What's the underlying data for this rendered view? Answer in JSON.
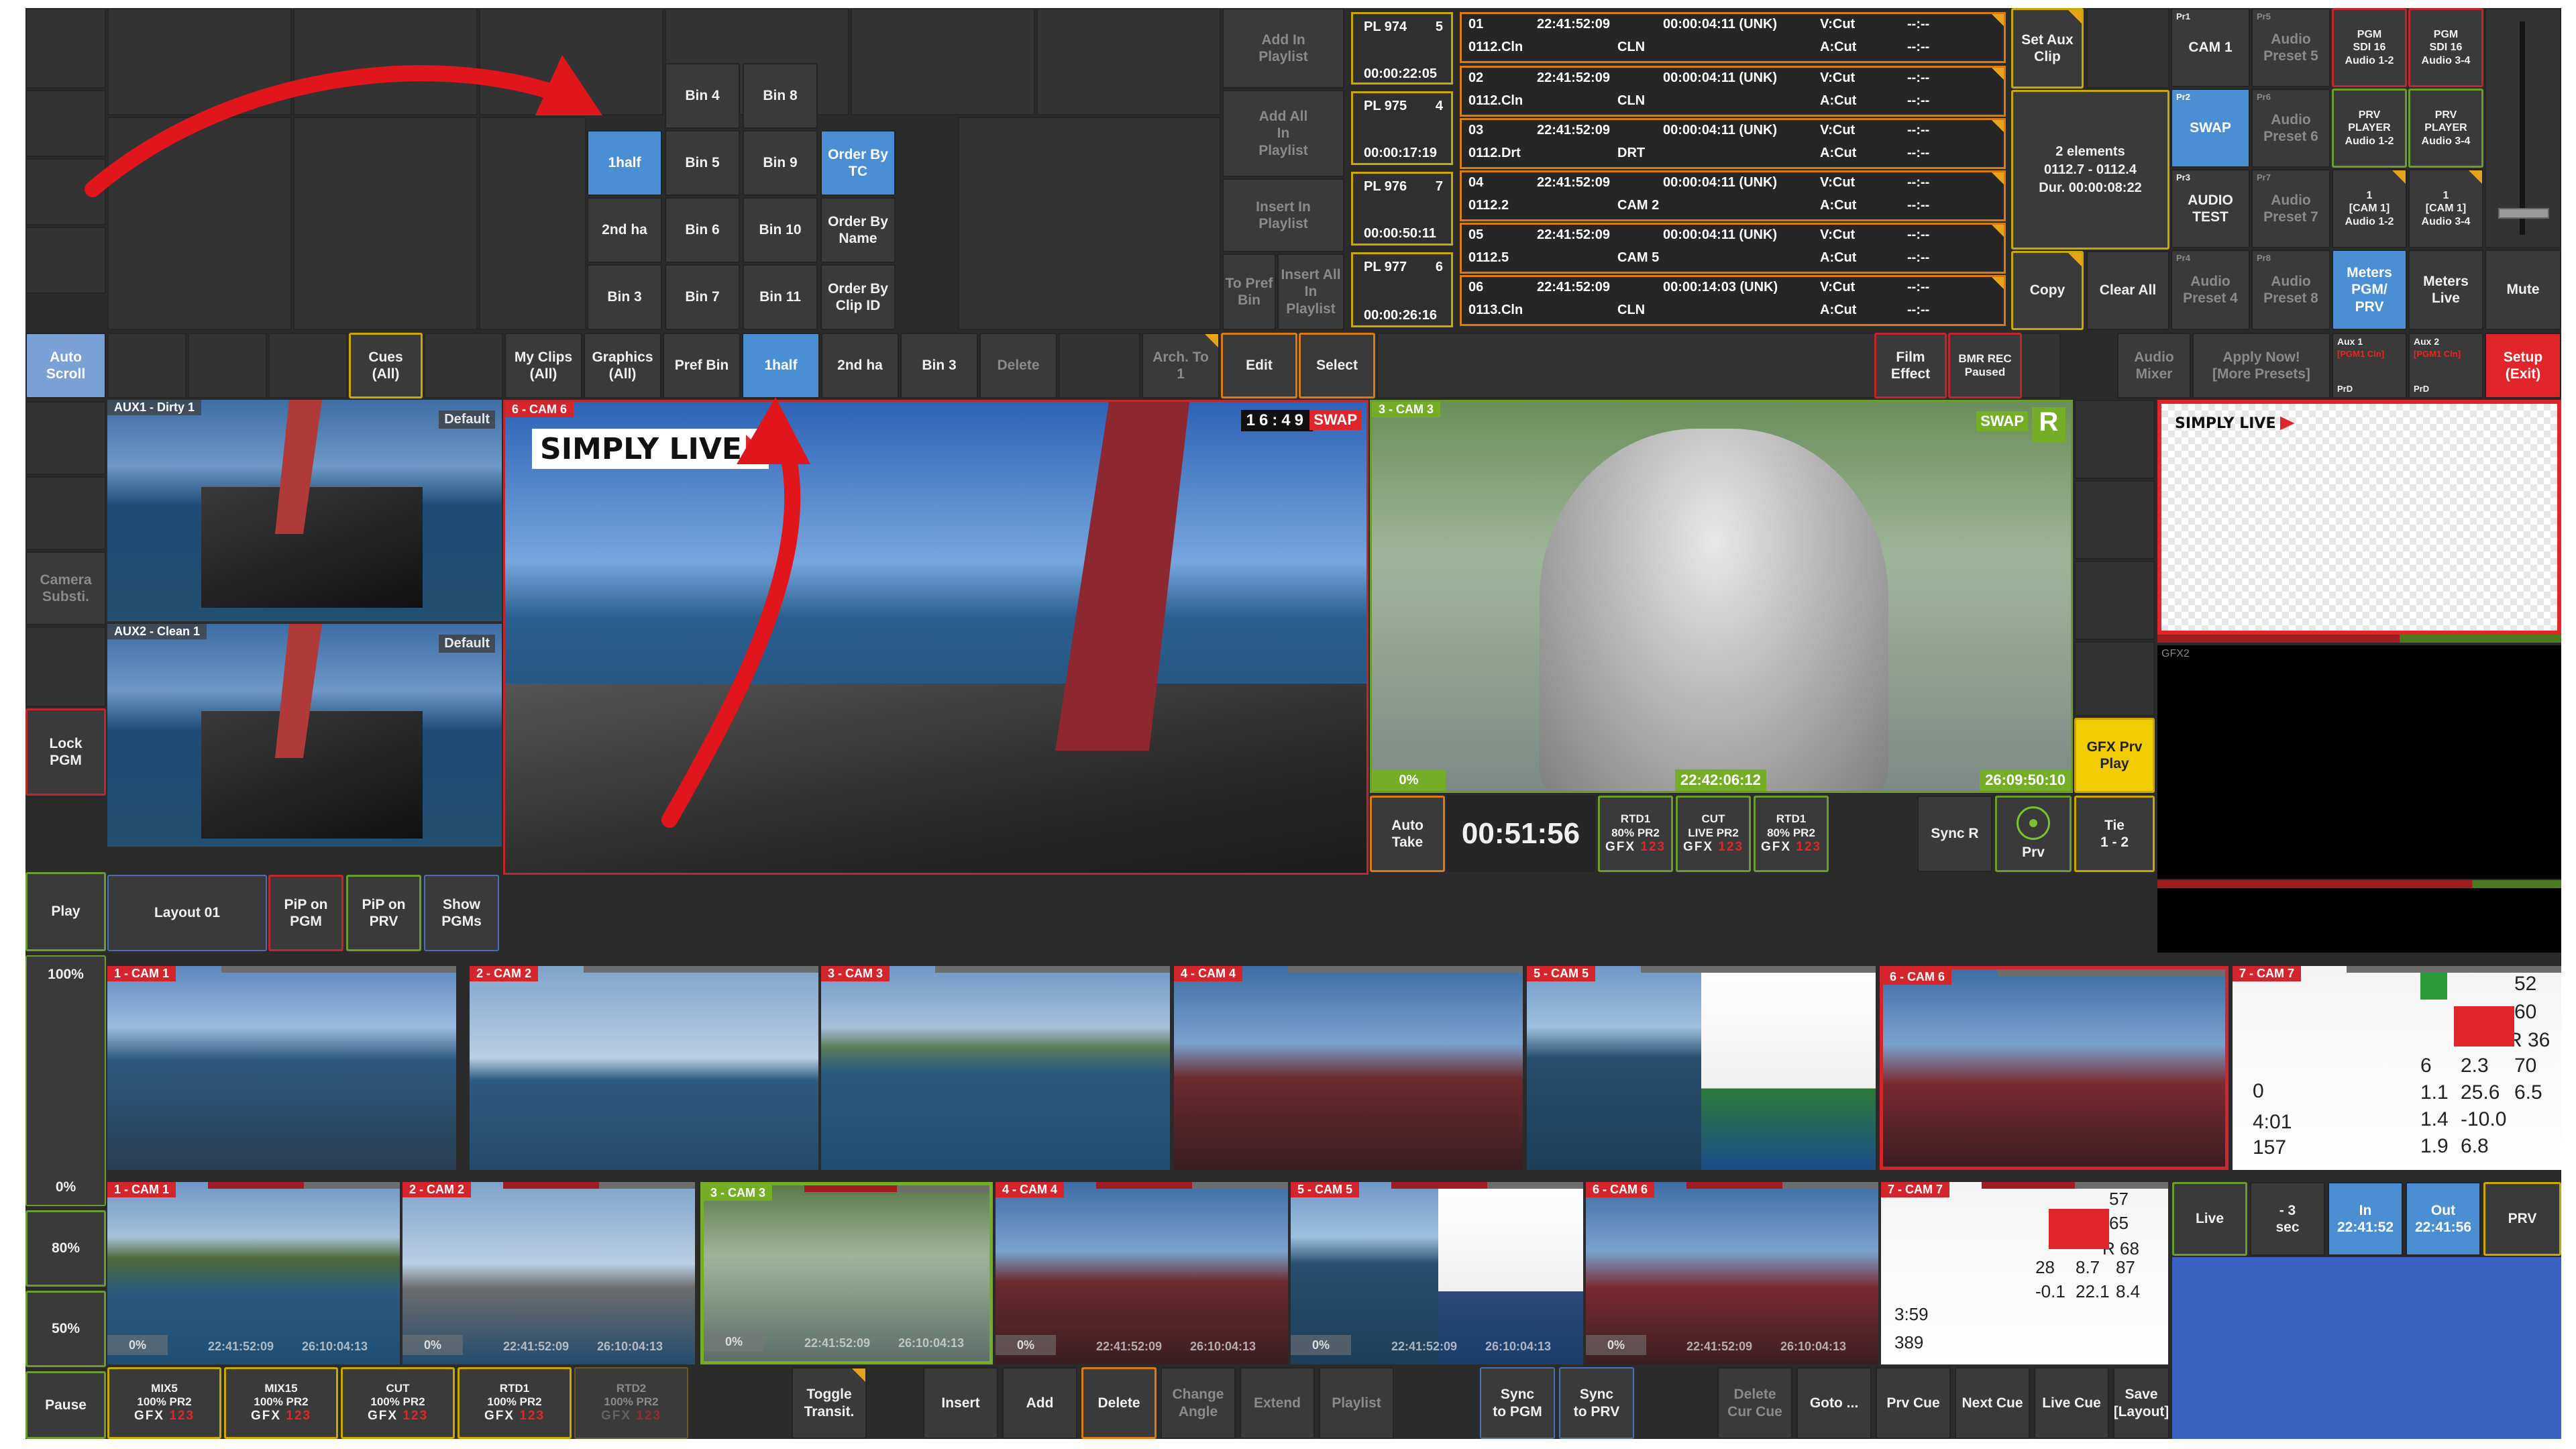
{
  "top": {
    "add_in_playlist": "Add In\nPlaylist",
    "add_all_in_playlist": "Add All\nIn\nPlaylist",
    "insert_in_playlist": "Insert In\nPlaylist",
    "to_pref_bin": "To Pref\nBin",
    "insert_all_in_playlist": "Insert All\nIn\nPlaylist",
    "bin4": "Bin 4",
    "bin8": "Bin 8",
    "half1": "1half",
    "bin5": "Bin 5",
    "bin9": "Bin 9",
    "order_tc": "Order By\nTC",
    "half2": "2nd ha",
    "bin6": "Bin 6",
    "bin10": "Bin 10",
    "order_name": "Order By\nName",
    "bin3": "Bin 3",
    "bin7": "Bin 7",
    "bin11": "Bin 11",
    "order_clip": "Order By\nClip ID"
  },
  "playlists": [
    {
      "name": "PL 974",
      "n": "5",
      "dur": "00:00:22:05"
    },
    {
      "name": "PL 975",
      "n": "4",
      "dur": "00:00:17:19"
    },
    {
      "name": "PL 976",
      "n": "7",
      "dur": "00:00:50:11"
    },
    {
      "name": "PL 977",
      "n": "6",
      "dur": "00:00:26:16"
    }
  ],
  "clips": [
    {
      "idx": "01",
      "tc": "22:41:52:09",
      "dur": "00:00:04:11 (UNK)",
      "v": "V:Cut",
      "a": "A:Cut",
      "d1": "--:--",
      "d2": "--:--",
      "id": "0112.Cln",
      "name": "CLN"
    },
    {
      "idx": "02",
      "tc": "22:41:52:09",
      "dur": "00:00:04:11 (UNK)",
      "v": "V:Cut",
      "a": "A:Cut",
      "d1": "--:--",
      "d2": "--:--",
      "id": "0112.Cln",
      "name": "CLN"
    },
    {
      "idx": "03",
      "tc": "22:41:52:09",
      "dur": "00:00:04:11 (UNK)",
      "v": "V:Cut",
      "a": "A:Cut",
      "d1": "--:--",
      "d2": "--:--",
      "id": "0112.Drt",
      "name": "DRT"
    },
    {
      "idx": "04",
      "tc": "22:41:52:09",
      "dur": "00:00:04:11 (UNK)",
      "v": "V:Cut",
      "a": "A:Cut",
      "d1": "--:--",
      "d2": "--:--",
      "id": "0112.2",
      "name": "CAM 2"
    },
    {
      "idx": "05",
      "tc": "22:41:52:09",
      "dur": "00:00:04:11 (UNK)",
      "v": "V:Cut",
      "a": "A:Cut",
      "d1": "--:--",
      "d2": "--:--",
      "id": "0112.5",
      "name": "CAM 5"
    },
    {
      "idx": "06",
      "tc": "22:41:52:09",
      "dur": "00:00:14:03 (UNK)",
      "v": "V:Cut",
      "a": "A:Cut",
      "d1": "--:--",
      "d2": "--:--",
      "id": "0113.Cln",
      "name": "CLN"
    }
  ],
  "right": {
    "set_aux": "Set Aux\nClip",
    "elements": "2 elements\n0112.7 - 0112.4\nDur. 00:00:08:22",
    "copy": "Copy",
    "clear_all": "Clear All",
    "pr1": "Pr1",
    "cam1": "CAM 1",
    "pr5": "Pr5",
    "ap5": "Audio\nPreset 5",
    "pgm_sdi_1": "PGM\nSDI 16\nAudio 1-2",
    "pgm_sdi_2": "PGM\nSDI 16\nAudio 3-4",
    "pr2": "Pr2",
    "swap": "SWAP",
    "pr6": "Pr6",
    "ap6": "Audio\nPreset 6",
    "prv_pl_1": "PRV\nPLAYER\nAudio 1-2",
    "prv_pl_2": "PRV\nPLAYER\nAudio 3-4",
    "pr3": "Pr3",
    "audio_test": "AUDIO\nTEST",
    "pr7": "Pr7",
    "ap7": "Audio\nPreset 7",
    "cam1a": "1\n[CAM 1]\nAudio 1-2",
    "cam1b": "1\n[CAM 1]\nAudio 3-4",
    "pr4": "Pr4",
    "ap4": "Audio\nPreset 4",
    "pr8": "Pr8",
    "ap8": "Audio\nPreset 8",
    "meters_pgm": "Meters\nPGM/\nPRV",
    "meters_live": "Meters\nLive",
    "mute": "Mute"
  },
  "row2": {
    "auto_scroll": "Auto\nScroll",
    "cues": "Cues\n(All)",
    "my_clips": "My Clips\n(All)",
    "graphics": "Graphics\n(All)",
    "pref_bin": "Pref Bin",
    "half1": "1half",
    "half2": "2nd ha",
    "bin3": "Bin 3",
    "delete": "Delete",
    "arch": "Arch. To\n1",
    "edit": "Edit",
    "select": "Select",
    "film": "Film\nEffect",
    "bmr": "BMR REC\nPaused",
    "audio_mixer": "Audio\nMixer",
    "apply": "Apply Now!\n[More Presets]",
    "aux1": "Aux 1",
    "aux1s": "[PGM1 Cln]",
    "prd1": "PrD",
    "aux2": "Aux 2",
    "aux2s": "[PGM1 Cln]",
    "prd2": "PrD",
    "setup": "Setup\n(Exit)"
  },
  "left": {
    "camera_subst": "Camera\nSubsti.",
    "lock_pgm": "Lock\nPGM",
    "play": "Play",
    "pct100": "100%",
    "pct0": "0%",
    "pct80": "80%",
    "pct50": "50%",
    "pause": "Pause"
  },
  "monitors": {
    "aux1": "AUX1 - Dirty 1",
    "aux1_default": "Default",
    "aux2": "AUX2 - Clean 1",
    "aux2_default": "Default",
    "pgm": "6 - CAM 6",
    "pgm_tc": "16:49",
    "swap": "SWAP",
    "logo": "SIMPLY LIVE",
    "prv": "3 - CAM 3",
    "prv_swap": "SWAP",
    "prv_r": "R",
    "prv_pct": "0%",
    "prv_tc": "22:42:06:12",
    "prv_tc2": "26:09:50:10",
    "gfx2": "GFX2",
    "gfx_prv": "GFX Prv\nPlay"
  },
  "controls": {
    "auto_take": "Auto\nTake",
    "timer": "00:51:56",
    "rtd1": "RTD1\n80% PR2",
    "cut": "CUT\nLIVE PR2",
    "rtd1b": "RTD1\n80% PR2",
    "gfx": "GFX",
    "g123": "123",
    "sync_r": "Sync R",
    "prv": "Prv",
    "tie": "Tie\n1 - 2"
  },
  "row3": {
    "layout": "Layout 01",
    "pip_pgm": "PiP on\nPGM",
    "pip_prv": "PiP on\nPRV",
    "show_pgms": "Show\nPGMs"
  },
  "cams_top": [
    "1 - CAM 1",
    "2 - CAM 2",
    "3 - CAM 3",
    "4 - CAM 4",
    "5 - CAM 5",
    "6 - CAM 6",
    "7 - CAM 7"
  ],
  "cams_bot": [
    "1 - CAM 1",
    "2 - CAM 2",
    "3 - CAM 3",
    "4 - CAM 4",
    "5 - CAM 5",
    "6 - CAM 6",
    "7 - CAM 7"
  ],
  "cam_pct": "0%",
  "cam_tc1": "22:41:52:09",
  "cam_tc2": "26:10:04:13",
  "nav": {
    "live": "Live",
    "minus3": "- 3\nsec",
    "in": "In\n22:41:52",
    "out": "Out\n22:41:56",
    "prv": "PRV"
  },
  "bottom": {
    "mix5": "MIX5\n100% PR2",
    "mix15": "MIX15\n100% PR2",
    "cut": "CUT\n100% PR2",
    "rtd1": "RTD1\n100% PR2",
    "rtd2": "RTD2\n100% PR2",
    "gfx": "GFX",
    "g123": "123",
    "toggle": "Toggle\nTransit.",
    "insert": "Insert",
    "add": "Add",
    "delete": "Delete",
    "change_angle": "Change\nAngle",
    "extend": "Extend",
    "playlist": "Playlist",
    "sync_pgm": "Sync\nto PGM",
    "sync_prv": "Sync\nto PRV",
    "delete_cue": "Delete\nCur Cue",
    "goto": "Goto ...",
    "prv_cue": "Prv Cue",
    "next_cue": "Next Cue",
    "live_cue": "Live Cue",
    "save": "Save\n[Layout]"
  },
  "gfx_numbers": {
    "n1": "52",
    "n2": "60",
    "n3": "R 36",
    "n4": "6",
    "n5": "2.3",
    "n6": "70",
    "n7": "1.1",
    "n8": "25.6",
    "n9": "6.5",
    "n10": "1.4",
    "n11": "-10.0",
    "n12": "1.9",
    "n13": "6.8",
    "n14": "4:01",
    "n15": "157",
    "n16": "0",
    "m1": "57",
    "m2": "65",
    "m3": "R 68",
    "m4": "28",
    "m5": "8.7",
    "m6": "87",
    "m7": "-0.1",
    "m8": "22.1",
    "m9": "8.4",
    "m10": "3:59",
    "m11": "389"
  }
}
